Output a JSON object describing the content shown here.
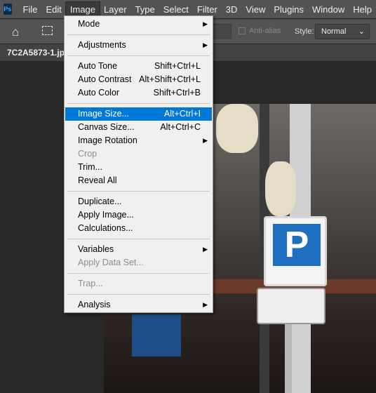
{
  "app": {
    "logo": "Ps",
    "accent": "#31a8ff"
  },
  "menubar": [
    "File",
    "Edit",
    "Image",
    "Layer",
    "Type",
    "Select",
    "Filter",
    "3D",
    "View",
    "Plugins",
    "Window",
    "Help"
  ],
  "active_menu": "Image",
  "options": {
    "anti_alias": "Anti-alias",
    "style_label": "Style:",
    "style_value": "Normal"
  },
  "document_tab": "7C2A5873-1.jpg",
  "image_menu": [
    {
      "label": "Mode",
      "submenu": true
    },
    {
      "sep": true
    },
    {
      "label": "Adjustments",
      "submenu": true
    },
    {
      "sep": true
    },
    {
      "label": "Auto Tone",
      "shortcut": "Shift+Ctrl+L"
    },
    {
      "label": "Auto Contrast",
      "shortcut": "Alt+Shift+Ctrl+L"
    },
    {
      "label": "Auto Color",
      "shortcut": "Shift+Ctrl+B"
    },
    {
      "sep": true
    },
    {
      "label": "Image Size...",
      "shortcut": "Alt+Ctrl+I",
      "highlighted": true
    },
    {
      "label": "Canvas Size...",
      "shortcut": "Alt+Ctrl+C"
    },
    {
      "label": "Image Rotation",
      "submenu": true
    },
    {
      "label": "Crop",
      "disabled": true
    },
    {
      "label": "Trim..."
    },
    {
      "label": "Reveal All"
    },
    {
      "sep": true
    },
    {
      "label": "Duplicate..."
    },
    {
      "label": "Apply Image..."
    },
    {
      "label": "Calculations..."
    },
    {
      "sep": true
    },
    {
      "label": "Variables",
      "submenu": true
    },
    {
      "label": "Apply Data Set...",
      "disabled": true
    },
    {
      "sep": true
    },
    {
      "label": "Trap...",
      "disabled": true
    },
    {
      "sep": true
    },
    {
      "label": "Analysis",
      "submenu": true
    }
  ]
}
